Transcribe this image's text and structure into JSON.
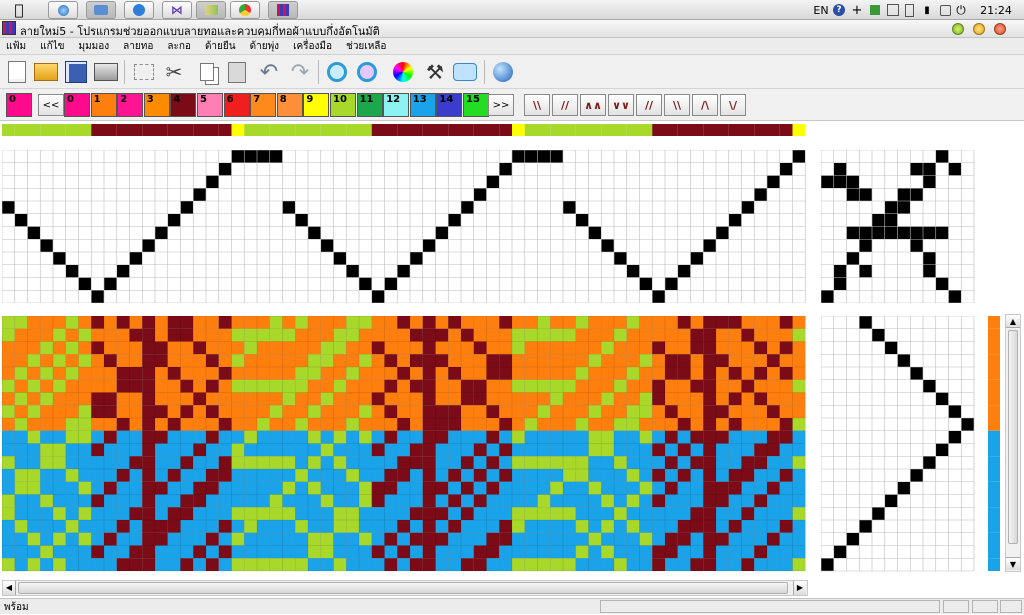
{
  "os": {
    "language": "EN",
    "clock": "21:24",
    "tasks": [
      "apple-icon",
      "orb-icon",
      "folder-icon",
      "browser-icon",
      "visual-studio-icon",
      "paint-icon",
      "chrome-icon",
      "weave-app-icon"
    ]
  },
  "window": {
    "title": "ลายใหม่5 - โปรแกรมช่วยออกแบบลายทอและควบคุมกี่ทอผ้าแบบกึ่งอัตโนมัติ"
  },
  "menu": [
    "แฟ้ม",
    "แก้ไข",
    "มุมมอง",
    "ลายทอ",
    "ละกอ",
    "ด้ายยืน",
    "ด้ายพุ่ง",
    "เครื่องมือ",
    "ช่วยเหลือ"
  ],
  "toolbar": [
    "new-icon",
    "open-icon",
    "save-icon",
    "print-icon",
    "select-icon",
    "cut-icon",
    "copy-icon",
    "paste-icon",
    "undo-icon",
    "redo-icon",
    "zoom-in-icon",
    "zoom-out-icon",
    "color-wheel-icon",
    "hammer-icon",
    "comment-icon",
    "globe-icon"
  ],
  "current_color": {
    "label": "0",
    "color": "#ff0a8c"
  },
  "nav": {
    "prev": "<<",
    "next": ">>"
  },
  "palette": [
    {
      "label": "0",
      "color": "#ff0a8c"
    },
    {
      "label": "1",
      "color": "#ff7f0e"
    },
    {
      "label": "2",
      "color": "#ff1493"
    },
    {
      "label": "3",
      "color": "#ff8c00"
    },
    {
      "label": "4",
      "color": "#7b0b16"
    },
    {
      "label": "5",
      "color": "#ff7fb5"
    },
    {
      "label": "6",
      "color": "#f01e1e"
    },
    {
      "label": "7",
      "color": "#ff8a1c"
    },
    {
      "label": "8",
      "color": "#ff8f38"
    },
    {
      "label": "9",
      "color": "#ffff00"
    },
    {
      "label": "10",
      "color": "#a8d82a"
    },
    {
      "label": "11",
      "color": "#1ca84a"
    },
    {
      "label": "12",
      "color": "#8cf2f2"
    },
    {
      "label": "13",
      "color": "#1aa3e8"
    },
    {
      "label": "14",
      "color": "#3c3ccc"
    },
    {
      "label": "15",
      "color": "#22dd22"
    }
  ],
  "twill_buttons": [
    "\\\\",
    "//",
    "∧∧",
    "∨∨",
    "//",
    "\\\\",
    "/\\",
    "\\/"
  ],
  "colors": {
    "lime": "#a8d82a",
    "maroon": "#7b0b16",
    "yellow": "#ffff00",
    "orange": "#ff7f0e",
    "blue": "#1aa3e8",
    "black": "#000000"
  },
  "status": {
    "text": "พร้อม"
  }
}
